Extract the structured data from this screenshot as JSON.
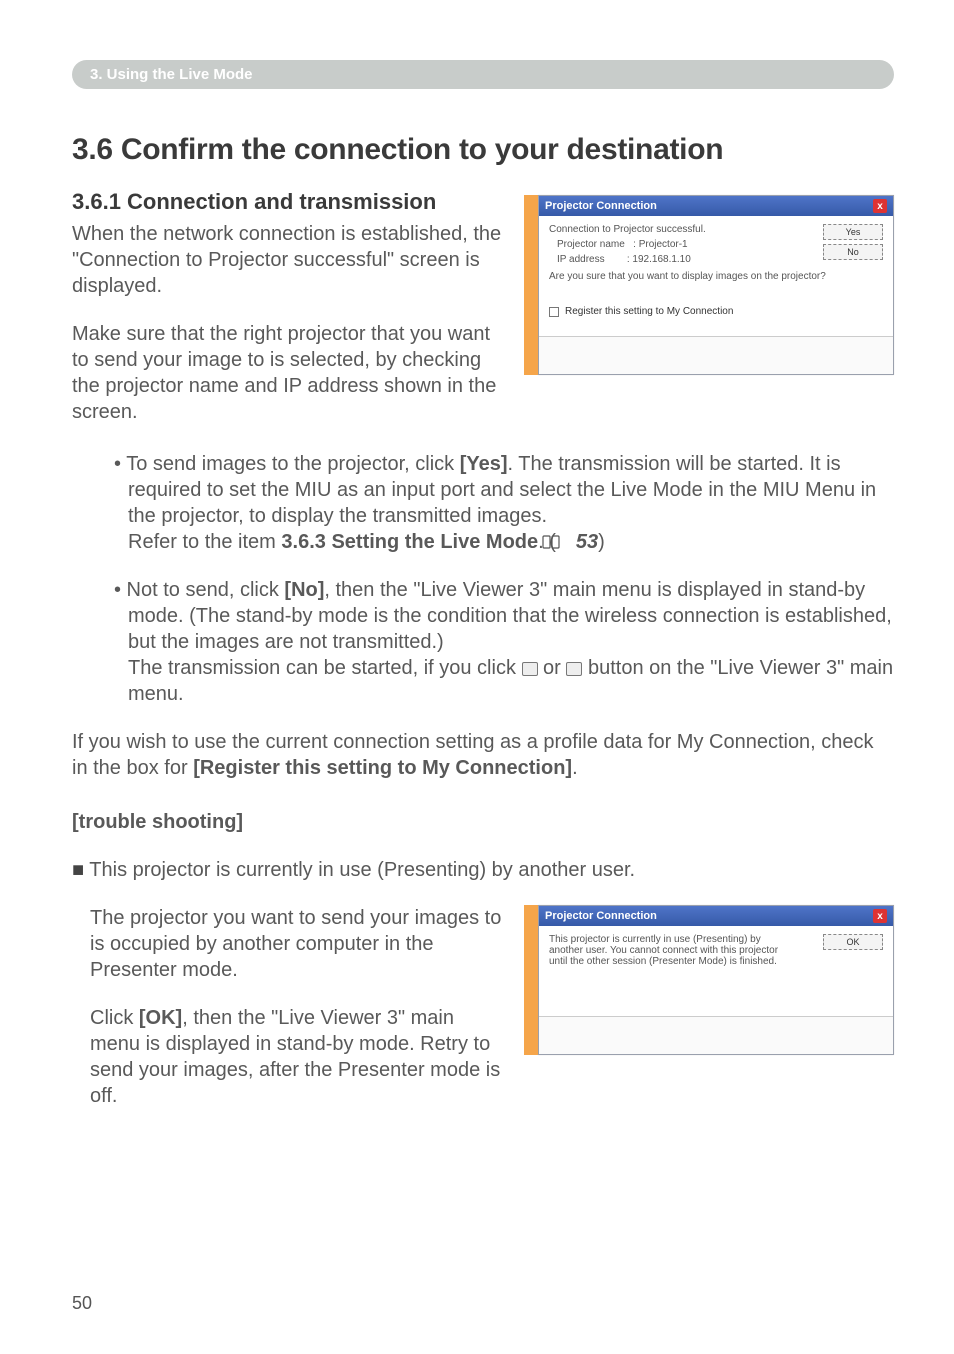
{
  "section_bar": "3. Using the Live Mode",
  "title": "3.6 Confirm the connection to your destination",
  "subhead": "3.6.1 Connection and transmission",
  "para1a": "When the network connection is established, the \"Connection to Projector successful\" screen is displayed.",
  "para1b": "Make sure that the right projector that you want to send your image to is selected, by checking the projector name and IP address shown in the screen.",
  "bullet1_pre": "• To send images to the projector, click ",
  "yes_label": "[Yes]",
  "bullet1_mid": ". The transmission will be started. It is required to set the MIU as an input port and select the Live Mode in the MIU Menu in the projector, to display the transmitted images.",
  "bullet1_refer_pre": "Refer to the item ",
  "bullet1_refer_bold": "3.6.3 Setting the Live Mode",
  "bullet1_refer_post": ". (",
  "bullet1_pageref": "53",
  "bullet1_refer_close": ")",
  "bullet2_pre": "• Not to send, click ",
  "no_label": "[No]",
  "bullet2_mid": ", then the \"Live Viewer 3\" main menu is displayed in stand-by mode. (The stand-by mode is the condition that the wireless connection is established, but the images are not transmitted.)",
  "bullet2_line2_pre": "The transmission can be started, if you click ",
  "bullet2_line2_mid": " or ",
  "bullet2_line2_post": " button on the \"Live Viewer 3\" main menu.",
  "para_wish_pre": "If you wish to use the current connection setting as a profile data for My Connection, check in the box for ",
  "para_wish_bold": "[Register this setting to My Connection]",
  "para_wish_post": ".",
  "ts_heading": "[trouble shooting]",
  "ts_bullet": "This projector is currently in use (Presenting) by another user.",
  "ts_para1": "The projector you want to send your images to is occupied by another computer in the Presenter mode.",
  "ts_para2_pre": "Click ",
  "ok_label": "[OK]",
  "ts_para2_post": ", then the \"Live Viewer 3\" main menu is displayed in stand-by mode. Retry to send your images, after the Presenter mode is off.",
  "dialog1": {
    "title": "Projector Connection",
    "msg": "Connection to Projector successful.",
    "row_name_label": "Projector name",
    "row_name_val": ": Projector-1",
    "row_ip_label": "IP address",
    "row_ip_val": ": 192.168.1.10",
    "confirm": "Are you sure that you want to display images on the projector?",
    "check_label": "Register this setting to My Connection",
    "btn_yes": "Yes",
    "btn_no": "No"
  },
  "dialog2": {
    "title": "Projector Connection",
    "msg": "This projector is currently in use (Presenting) by another user. You cannot connect with this projector until the other session (Presenter Mode) is finished.",
    "btn_ok": "OK"
  },
  "page_number": "50"
}
